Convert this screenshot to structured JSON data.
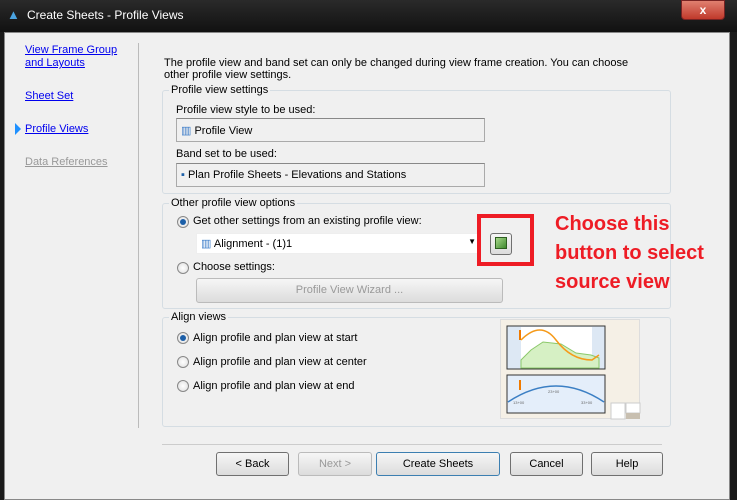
{
  "window": {
    "title": "Create Sheets - Profile Views",
    "close": "x"
  },
  "nav": {
    "items": [
      {
        "label": "View Frame Group and Layouts",
        "state": "link"
      },
      {
        "label": "Sheet Set",
        "state": "link"
      },
      {
        "label": "Profile Views",
        "state": "current"
      },
      {
        "label": "Data References",
        "state": "disabled"
      }
    ]
  },
  "intro": "The profile view and band set can only be changed during view frame creation. You can choose other profile view settings.",
  "profile_settings": {
    "legend": "Profile view settings",
    "style_label": "Profile view style to be used:",
    "style_value": "Profile View",
    "band_label": "Band set to be used:",
    "band_value": "Plan Profile Sheets - Elevations and Stations"
  },
  "other_options": {
    "legend": "Other profile view options",
    "radio_existing": "Get other settings from an existing profile view:",
    "selected": "Alignment - (1)1",
    "radio_choose": "Choose settings:",
    "wizard": "Profile View Wizard ..."
  },
  "align": {
    "legend": "Align views",
    "options": [
      "Align profile and plan view at start",
      "Align profile and plan view at center",
      "Align profile and plan view at end"
    ],
    "selected_index": 0,
    "stations": [
      "13+00",
      "23+00",
      "33+00"
    ]
  },
  "buttons": {
    "back": "< Back",
    "next": "Next >",
    "create": "Create Sheets",
    "cancel": "Cancel",
    "help": "Help"
  },
  "annotation": {
    "lines": [
      "Choose this",
      "button to select",
      "source view"
    ],
    "color": "#ee1c25"
  }
}
